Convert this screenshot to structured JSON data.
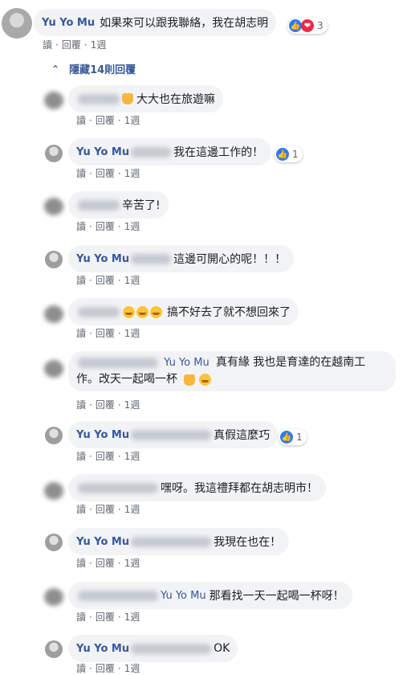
{
  "top_comment": {
    "author": "Yu Yo Mu",
    "text": "如果來可以跟我聯絡，我在胡志明",
    "reaction_count": "3",
    "actions": [
      "讀",
      "回覆",
      "1週"
    ]
  },
  "hidden_replies": "隱藏14則回覆",
  "replies": [
    {
      "text": "大大也在旅遊嘛",
      "actions": [
        "讀",
        "回覆",
        "1週"
      ]
    },
    {
      "author": "Yu Yo Mu",
      "text": "我在這邊工作的！",
      "reaction_count": "1",
      "actions": [
        "讀",
        "回覆",
        "1週"
      ]
    },
    {
      "text": "辛苦了!",
      "actions": [
        "讀",
        "回覆",
        "1週"
      ]
    },
    {
      "author": "Yu Yo Mu",
      "text": "這邊可開心的呢！！！",
      "actions": [
        "讀",
        "回覆",
        "1週"
      ]
    },
    {
      "text": "搞不好去了就不想回來了",
      "actions": [
        "讀",
        "回覆",
        "1週"
      ]
    },
    {
      "mention": "Yu Yo Mu",
      "text": "真有緣 我也是育達的在越南工",
      "text2": "作。改天一起喝一杯",
      "actions": [
        "讀",
        "回覆",
        "1週"
      ]
    },
    {
      "author": "Yu Yo Mu",
      "text": "真假這麼巧",
      "reaction_count": "1",
      "actions": [
        "讀",
        "回覆",
        "1週"
      ]
    },
    {
      "text": "嘿呀。我這禮拜都在胡志明市！",
      "actions": [
        "讀",
        "回覆",
        "1週"
      ]
    },
    {
      "author": "Yu Yo Mu",
      "text": "我現在也在！",
      "actions": [
        "讀",
        "回覆",
        "1週"
      ]
    },
    {
      "mention": "Yu Yo Mu",
      "text": "那看找一天一起喝一杯呀！",
      "actions": [
        "讀",
        "回覆",
        "1週"
      ]
    },
    {
      "author": "Yu Yo Mu",
      "text": "OK",
      "actions": [
        "讀",
        "回覆",
        "1週"
      ]
    }
  ]
}
